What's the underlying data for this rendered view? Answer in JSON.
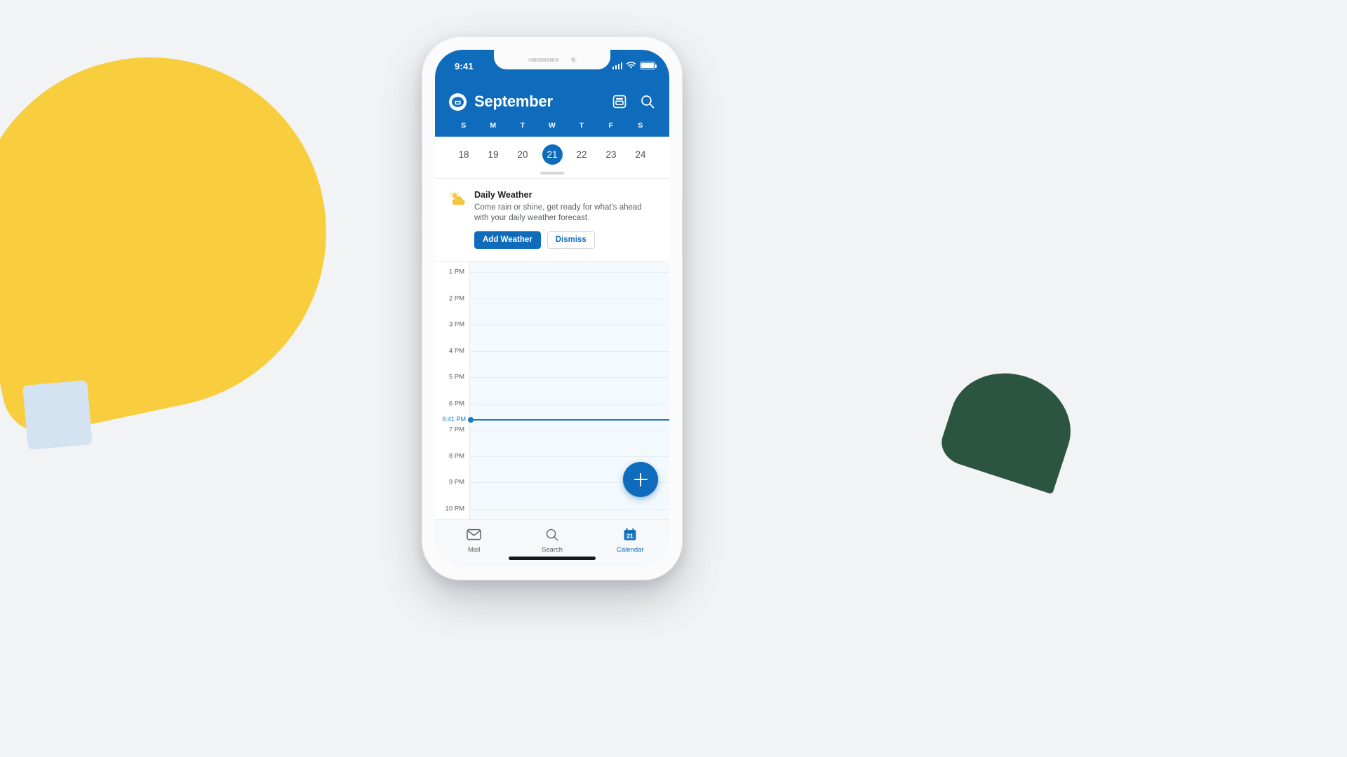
{
  "background": {
    "page_color": "#F2F3F4",
    "shapes": [
      {
        "name": "yellow-teardrop",
        "color": "#F8CE3E"
      },
      {
        "name": "light-blue-square",
        "color": "#D3E3F2"
      },
      {
        "name": "dark-green-wedge",
        "color": "#2C5541"
      }
    ]
  },
  "phone": {
    "status_bar": {
      "time": "9:41",
      "signal_icon": "cellular-signal-icon",
      "wifi_icon": "wifi-icon",
      "battery_icon": "battery-icon"
    },
    "header": {
      "avatar_icon": "account-avatar-icon",
      "title": "September",
      "actions": [
        {
          "name": "view-switcher-icon",
          "label": "Calendar view"
        },
        {
          "name": "search-icon",
          "label": "Search"
        }
      ]
    },
    "weekdays": [
      "S",
      "M",
      "T",
      "W",
      "T",
      "F",
      "S"
    ],
    "dates": [
      {
        "num": "18",
        "selected": false
      },
      {
        "num": "19",
        "selected": false
      },
      {
        "num": "20",
        "selected": false
      },
      {
        "num": "21",
        "selected": true
      },
      {
        "num": "22",
        "selected": false
      },
      {
        "num": "23",
        "selected": false
      },
      {
        "num": "24",
        "selected": false
      }
    ],
    "weather_card": {
      "icon": "sun-behind-cloud-icon",
      "title": "Daily Weather",
      "description": "Come rain or shine, get ready for what's ahead with your daily weather forecast.",
      "primary_button": "Add Weather",
      "secondary_button": "Dismiss"
    },
    "timeline": {
      "hours": [
        "1 PM",
        "2 PM",
        "3 PM",
        "4 PM",
        "5 PM",
        "6 PM",
        "7 PM",
        "8 PM",
        "9 PM",
        "10 PM"
      ],
      "current_time_label": "6:41 PM",
      "current_time_color": "#1A7BC9",
      "fab": {
        "name": "add-event-button",
        "icon": "plus-icon"
      }
    },
    "tabbar": {
      "tabs": [
        {
          "icon": "mail-icon",
          "label": "Mail",
          "active": false
        },
        {
          "icon": "search-icon",
          "label": "Search",
          "active": false
        },
        {
          "icon": "calendar-icon",
          "label": "Calendar",
          "active": true,
          "badge": "21"
        }
      ]
    },
    "accent_color": "#0F6CBD"
  }
}
